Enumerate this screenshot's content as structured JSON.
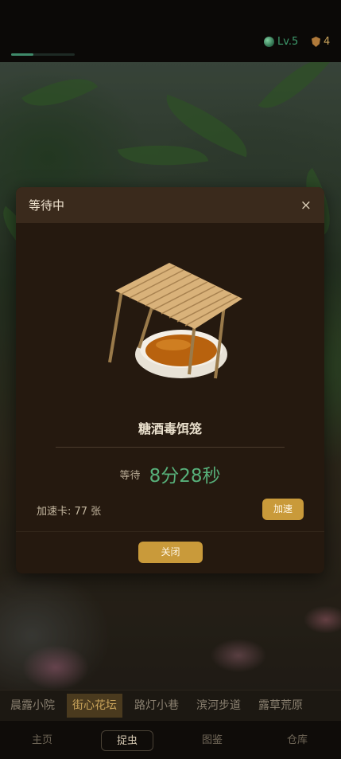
{
  "status": {
    "level": "Lv.5",
    "coins": "4",
    "progress": 0.35
  },
  "modal": {
    "title": "等待中",
    "close_icon": "×",
    "item_name": "糖酒毒饵笼",
    "wait_label": "等待",
    "wait_time": "8分28秒",
    "speed_card_text": "加速卡: 77 张",
    "speed_button": "加速",
    "close_button": "关闭"
  },
  "locations": [
    "晨露小院",
    "街心花坛",
    "路灯小巷",
    "滨河步道",
    "露草荒原"
  ],
  "active_location": 1,
  "tabs": [
    "主页",
    "捉虫",
    "图鉴",
    "仓库"
  ],
  "active_tab": 1,
  "colors": {
    "accent_gold": "#c99a3a",
    "timer_green": "#57b07a",
    "level_green": "#3e9a6c"
  }
}
